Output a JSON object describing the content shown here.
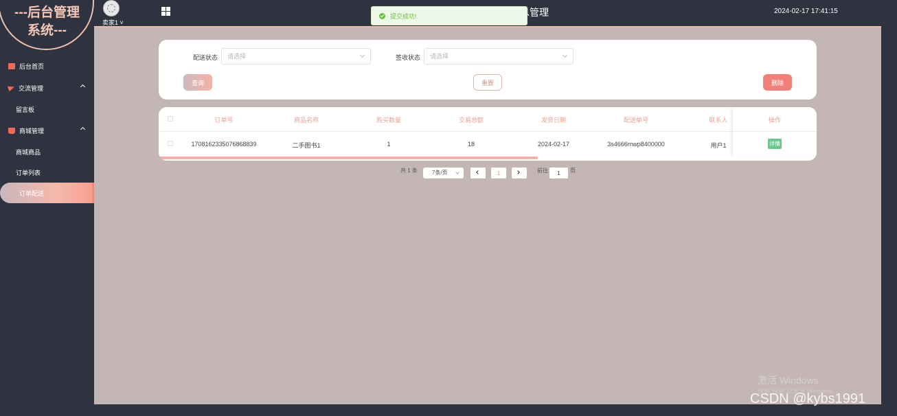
{
  "sidebar": {
    "logo": "---后台管理系统---",
    "logo_line1": "---后台管理",
    "logo_line2": "系统---",
    "items": [
      {
        "label": "后台首页",
        "icon": "monitor-icon"
      },
      {
        "label": "交流管理",
        "icon": "send-icon",
        "expanded": true,
        "children": [
          "留言板"
        ]
      },
      {
        "label": "商城管理",
        "icon": "shop-icon",
        "expanded": true,
        "children": [
          "商城商品",
          "订单列表",
          "订单配送"
        ]
      }
    ],
    "active": "订单配送"
  },
  "header": {
    "user": "卖家1",
    "title": "信息管理",
    "title_visible": "息管理",
    "time": "2024-02-17 17:41:15",
    "accent": "#f3b7a8"
  },
  "toast": {
    "message": "提交成功!",
    "color": "#67c23a"
  },
  "search": {
    "delivery_status_label": "配送状态",
    "delivery_status_placeholder": "请选择",
    "sign_status_label": "签收状态",
    "sign_status_placeholder": "请选择",
    "query_label": "查询",
    "reset_label": "重置",
    "delete_label": "删除"
  },
  "table": {
    "columns": [
      "订单号",
      "商品名称",
      "购买数量",
      "交易总额",
      "发货日期",
      "配送单号",
      "联系人",
      "操作"
    ],
    "rows": [
      {
        "order_no": "1708162335076868839",
        "product": "二手图书1",
        "qty": "1",
        "total": "18",
        "ship_date": "2024-02-17",
        "delivery_no": "3s4666mwp8400000",
        "contact": "用户1",
        "action": "详情"
      }
    ]
  },
  "pagination": {
    "total": "共 1 条",
    "page_size": "7条/页",
    "current_page": "1",
    "goto_label": "前往",
    "goto_value": "1",
    "page_suffix": "页"
  },
  "watermarks": {
    "windows_line1": "激活 Windows",
    "windows_line2": "转到\"设置\"以激活 Windows。",
    "csdn": "CSDN @kybs1991"
  }
}
